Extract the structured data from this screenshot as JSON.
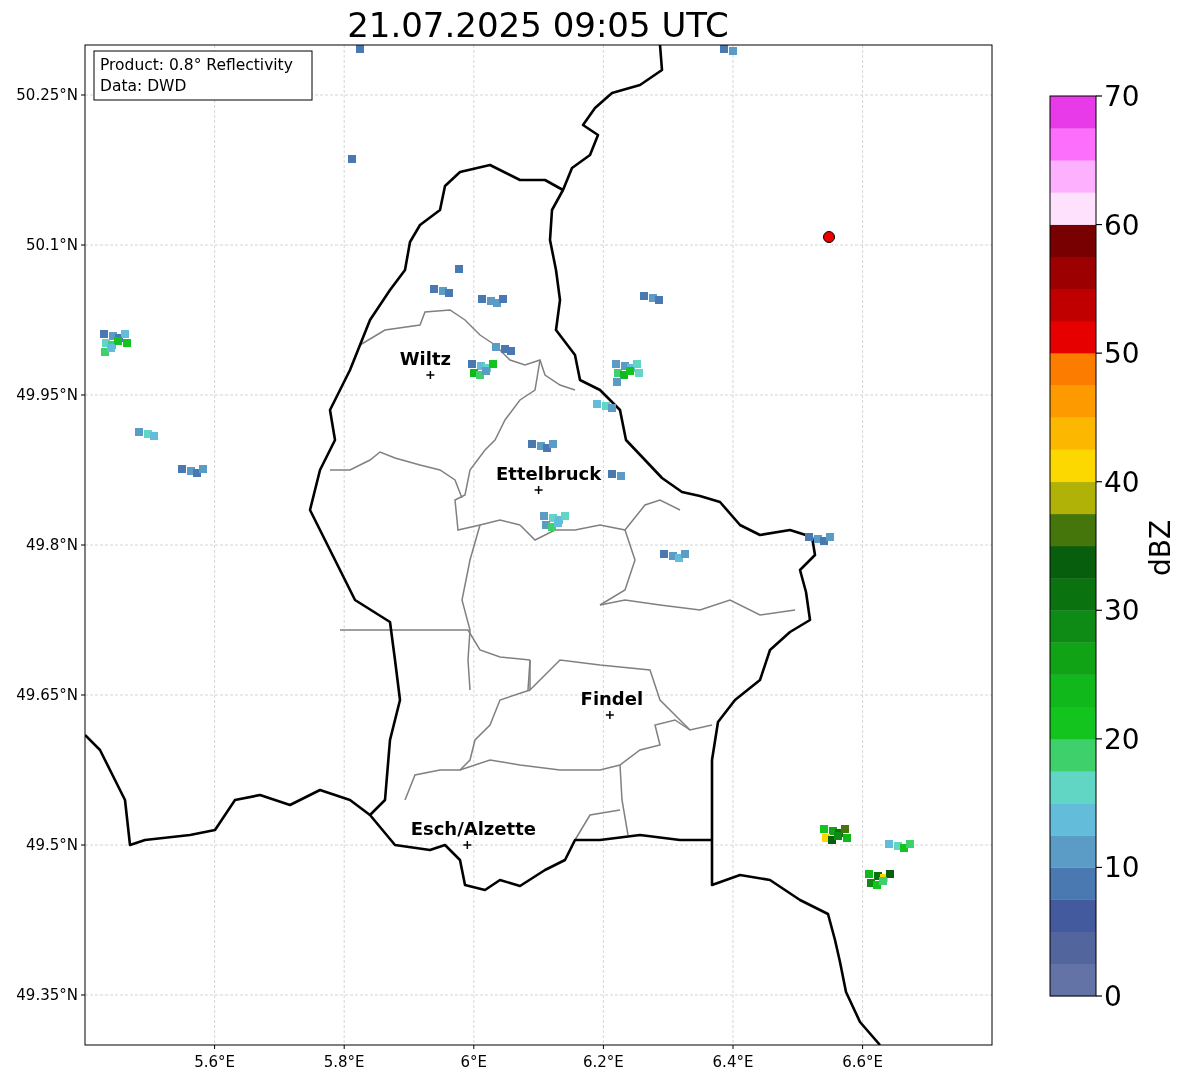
{
  "title": "21.07.2025 09:05 UTC",
  "annotation": [
    "Product: 0.8° Reflectivity",
    "Data: DWD"
  ],
  "x_ticks": [
    "5.6°E",
    "5.8°E",
    "6°E",
    "6.2°E",
    "6.4°E",
    "6.6°E"
  ],
  "y_ticks": [
    "50.25°N",
    "50.1°N",
    "49.95°N",
    "49.8°N",
    "49.65°N",
    "49.5°N",
    "49.35°N"
  ],
  "cities": [
    {
      "name": "Wiltz"
    },
    {
      "name": "Ettelbruck"
    },
    {
      "name": "Findel"
    },
    {
      "name": "Esch/Alzette"
    }
  ],
  "colorbar": {
    "label": "dBZ",
    "ticks": [
      "70",
      "60",
      "50",
      "40",
      "30",
      "20",
      "10",
      "0"
    ],
    "segments": [
      {
        "color": "#6473a6"
      },
      {
        "color": "#53659d"
      },
      {
        "color": "#435a9f"
      },
      {
        "color": "#4a78b1"
      },
      {
        "color": "#5a9cc6"
      },
      {
        "color": "#64bcdb"
      },
      {
        "color": "#62d6c4"
      },
      {
        "color": "#3dd06b"
      },
      {
        "color": "#13c41e"
      },
      {
        "color": "#10b81b"
      },
      {
        "color": "#10a316"
      },
      {
        "color": "#0e8b14"
      },
      {
        "color": "#0a7310"
      },
      {
        "color": "#075e0d"
      },
      {
        "color": "#45760c"
      },
      {
        "color": "#b1b208"
      },
      {
        "color": "#fcd700"
      },
      {
        "color": "#fcb700"
      },
      {
        "color": "#fc9a00"
      },
      {
        "color": "#fc7c00"
      },
      {
        "color": "#e60000"
      },
      {
        "color": "#c00000"
      },
      {
        "color": "#9c0000"
      },
      {
        "color": "#780000"
      },
      {
        "color": "#fde1fd"
      },
      {
        "color": "#fdb0fd"
      },
      {
        "color": "#fc6efc"
      },
      {
        "color": "#e83ae8"
      }
    ]
  }
}
